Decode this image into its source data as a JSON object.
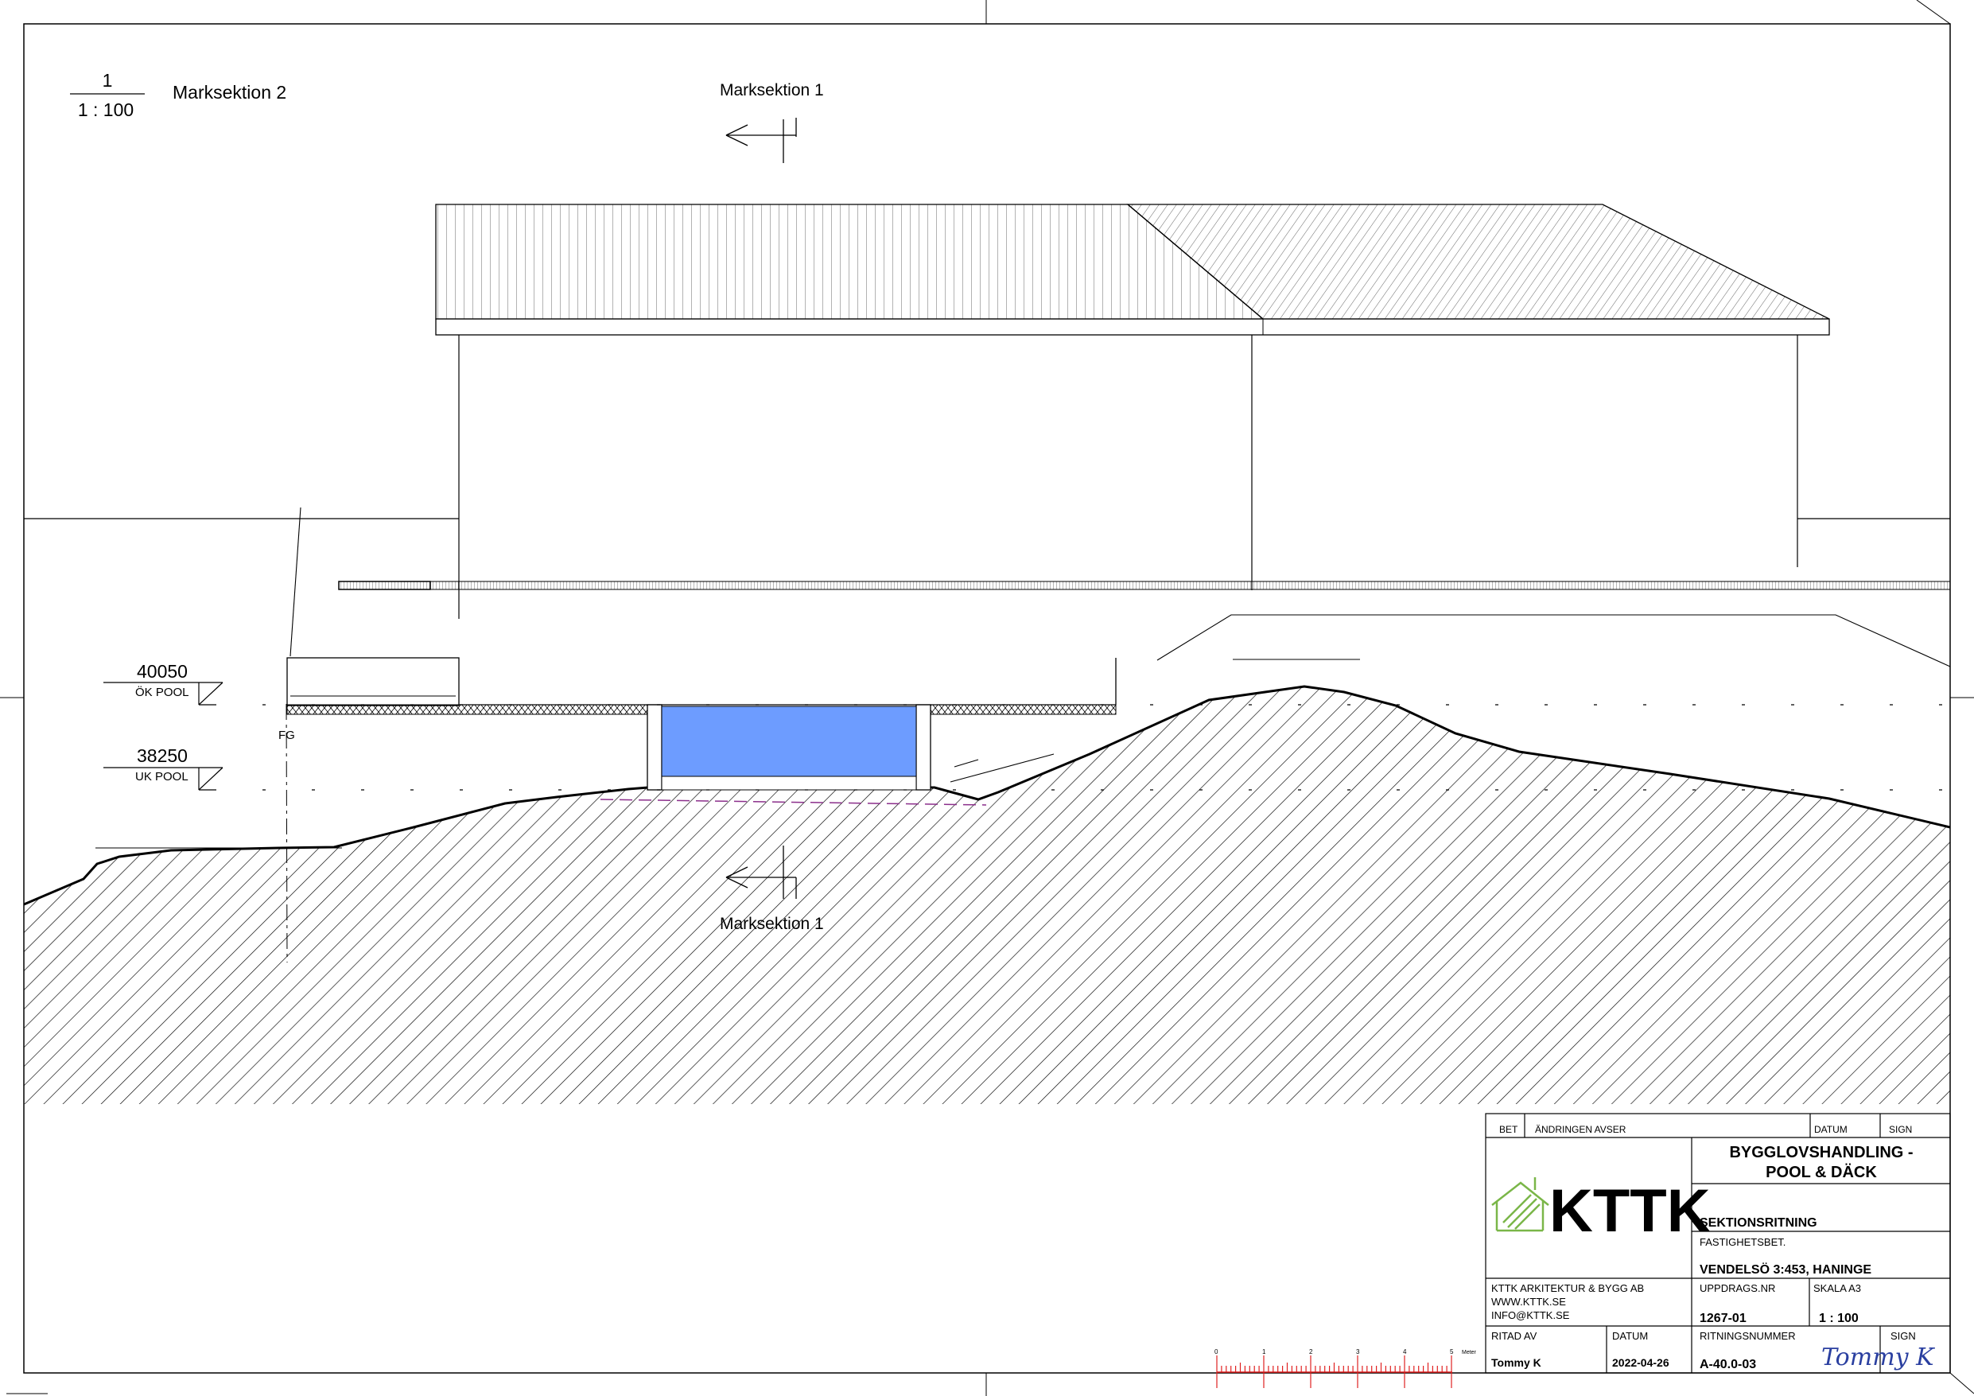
{
  "view": {
    "number": "1",
    "scale": "1 : 100",
    "title": "Marksektion 2"
  },
  "section_marker": {
    "label": "Marksektion 1"
  },
  "levels": [
    {
      "value": "40050",
      "label": "ÖK POOL"
    },
    {
      "value": "38250",
      "label": "UK POOL"
    }
  ],
  "ground_label": "FG",
  "colors": {
    "pool_water": "#6d9cff",
    "pool_line": "#8b2f8b",
    "scale_bar": "#e02020",
    "logo_green": "#7ab648",
    "signature": "#2a3fa0"
  },
  "scale_bar": {
    "ticks": [
      "0",
      "1",
      "2",
      "3",
      "4",
      "5"
    ],
    "unit": "Meter"
  },
  "title_block": {
    "header": {
      "bet": "BET",
      "andring": "ÄNDRINGEN AVSER",
      "datum": "DATUM",
      "sign": "SIGN"
    },
    "logo_text": "KTTK",
    "logo_icon": "house-icon",
    "project_title_line1": "BYGGLOVSHANDLING -",
    "project_title_line2": "POOL & DÄCK",
    "drawing_type": "SEKTIONSRITNING",
    "property_label": "FASTIGHETSBET.",
    "property_value": "VENDELSÖ 3:453, HANINGE",
    "company_line1": "KTTK ARKITEKTUR & BYGG AB",
    "company_line2": "WWW.KTTK.SE",
    "company_line3": "INFO@KTTK.SE",
    "uppdrag_label": "UPPDRAGS.NR",
    "uppdrag_value": "1267-01",
    "skala_label": "SKALA A3",
    "skala_value": "1 : 100",
    "ritad_label": "RITAD AV",
    "ritad_value": "Tommy K",
    "datum_label": "DATUM",
    "datum_value": "2022-04-26",
    "ritningsnr_label": "RITNINGSNUMMER",
    "ritningsnr_value": "A-40.0-03",
    "sign_label": "SIGN",
    "signature": "Tommy K"
  }
}
